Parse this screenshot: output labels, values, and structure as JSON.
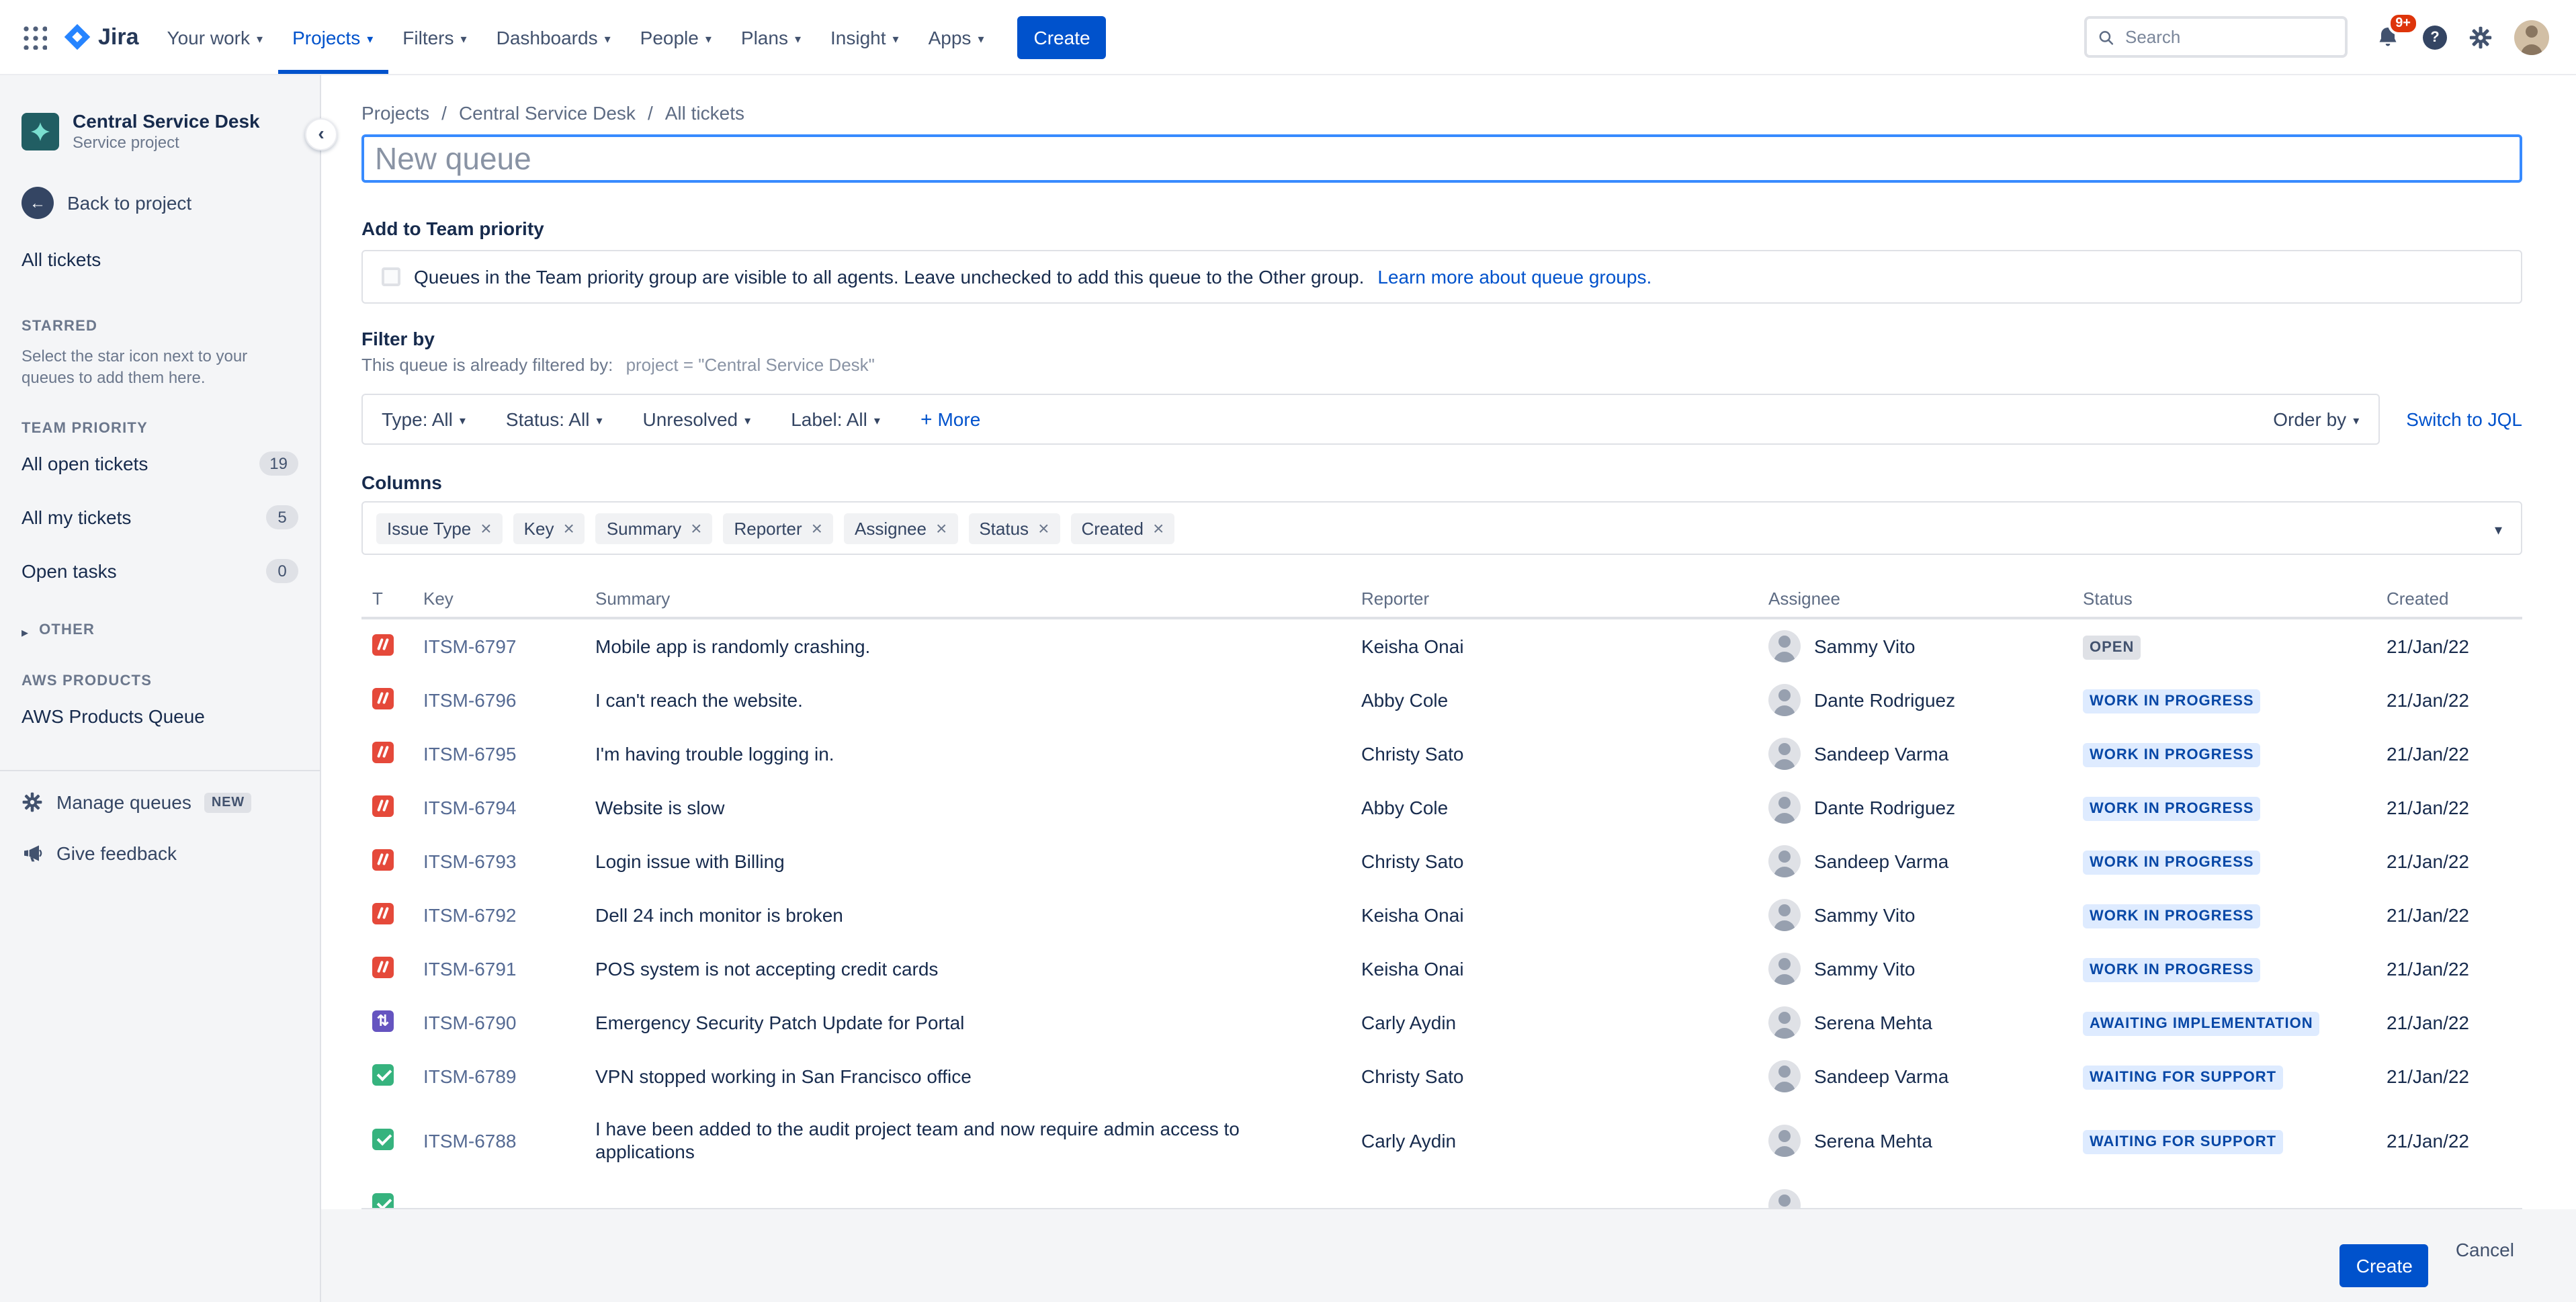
{
  "colors": {
    "accent": "#0052CC",
    "incident_icon": "#E5493A",
    "change_icon": "#6554C0",
    "request_icon": "#36B37E",
    "badge_blue_bg": "#DEEBFF",
    "badge_blue_text": "#0747A6",
    "badge_gray_bg": "#DFE1E6",
    "notification_badge_bg": "#DE350B"
  },
  "nav": {
    "logo": "Jira",
    "items": [
      {
        "label": "Your work"
      },
      {
        "label": "Projects"
      },
      {
        "label": "Filters"
      },
      {
        "label": "Dashboards"
      },
      {
        "label": "People"
      },
      {
        "label": "Plans"
      },
      {
        "label": "Insight"
      },
      {
        "label": "Apps"
      }
    ],
    "create_label": "Create",
    "search_placeholder": "Search",
    "notification_badge": "9+"
  },
  "sidebar": {
    "project_name": "Central Service Desk",
    "project_type": "Service project",
    "back_label": "Back to project",
    "all_tickets_label": "All tickets",
    "starred_heading": "STARRED",
    "starred_hint": "Select the star icon next to your queues to add them here.",
    "team_priority_heading": "TEAM PRIORITY",
    "queues": [
      {
        "label": "All open tickets",
        "count": "19"
      },
      {
        "label": "All my tickets",
        "count": "5"
      },
      {
        "label": "Open tasks",
        "count": "0"
      }
    ],
    "other_heading": "OTHER",
    "aws_heading": "AWS PRODUCTS",
    "aws_queue_label": "AWS Products Queue",
    "manage_queues_label": "Manage queues",
    "new_badge": "NEW",
    "feedback_label": "Give feedback"
  },
  "main": {
    "breadcrumb": [
      {
        "label": "Projects"
      },
      {
        "label": "Central Service Desk"
      },
      {
        "label": "All tickets"
      }
    ],
    "queue_name_placeholder": "New queue",
    "team_priority": {
      "heading": "Add to Team priority",
      "checkbox_text": "Queues in the Team priority group are visible to all agents. Leave unchecked to add this queue to the Other group.",
      "link_label": "Learn more about queue groups."
    },
    "filter": {
      "heading": "Filter by",
      "prefilter_label": "This queue is already filtered by:",
      "prefilter_jql": "project = \"Central Service Desk\"",
      "dropdowns": [
        {
          "label": "Type: All"
        },
        {
          "label": "Status: All"
        },
        {
          "label": "Unresolved"
        },
        {
          "label": "Label: All"
        }
      ],
      "more_label": "More",
      "order_by_label": "Order by",
      "switch_jql_label": "Switch to JQL"
    },
    "columns": {
      "heading": "Columns",
      "chips": [
        {
          "label": "Issue Type"
        },
        {
          "label": "Key"
        },
        {
          "label": "Summary"
        },
        {
          "label": "Reporter"
        },
        {
          "label": "Assignee"
        },
        {
          "label": "Status"
        },
        {
          "label": "Created"
        }
      ]
    },
    "table": {
      "headers": {
        "type": "T",
        "key": "Key",
        "summary": "Summary",
        "reporter": "Reporter",
        "assignee": "Assignee",
        "status": "Status",
        "created": "Created"
      },
      "rows": [
        {
          "type": "incident",
          "key": "ITSM-6797",
          "summary": "Mobile app is randomly crashing.",
          "reporter": "Keisha Onai",
          "assignee": "Sammy Vito",
          "status": "OPEN",
          "created": "21/Jan/22"
        },
        {
          "type": "incident",
          "key": "ITSM-6796",
          "summary": "I can't reach the website.",
          "reporter": "Abby Cole",
          "assignee": "Dante Rodriguez",
          "status": "WORK IN PROGRESS",
          "created": "21/Jan/22"
        },
        {
          "type": "incident",
          "key": "ITSM-6795",
          "summary": "I'm having trouble logging in.",
          "reporter": "Christy Sato",
          "assignee": "Sandeep Varma",
          "status": "WORK IN PROGRESS",
          "created": "21/Jan/22"
        },
        {
          "type": "incident",
          "key": "ITSM-6794",
          "summary": "Website is slow",
          "reporter": "Abby Cole",
          "assignee": "Dante Rodriguez",
          "status": "WORK IN PROGRESS",
          "created": "21/Jan/22"
        },
        {
          "type": "incident",
          "key": "ITSM-6793",
          "summary": "Login issue with Billing",
          "reporter": "Christy Sato",
          "assignee": "Sandeep Varma",
          "status": "WORK IN PROGRESS",
          "created": "21/Jan/22"
        },
        {
          "type": "incident",
          "key": "ITSM-6792",
          "summary": "Dell 24 inch monitor is broken",
          "reporter": "Keisha Onai",
          "assignee": "Sammy Vito",
          "status": "WORK IN PROGRESS",
          "created": "21/Jan/22"
        },
        {
          "type": "incident",
          "key": "ITSM-6791",
          "summary": "POS system is not accepting credit cards",
          "reporter": "Keisha Onai",
          "assignee": "Sammy Vito",
          "status": "WORK IN PROGRESS",
          "created": "21/Jan/22"
        },
        {
          "type": "change",
          "key": "ITSM-6790",
          "summary": "Emergency Security Patch Update for Portal",
          "reporter": "Carly Aydin",
          "assignee": "Serena Mehta",
          "status": "AWAITING IMPLEMENTATION",
          "created": "21/Jan/22"
        },
        {
          "type": "request",
          "key": "ITSM-6789",
          "summary": "VPN stopped working in San Francisco office",
          "reporter": "Christy Sato",
          "assignee": "Sandeep Varma",
          "status": "WAITING FOR SUPPORT",
          "created": "21/Jan/22"
        },
        {
          "type": "request",
          "key": "ITSM-6788",
          "summary": "I have been added to the audit project team and now require admin access to applications",
          "reporter": "Carly Aydin",
          "assignee": "Serena Mehta",
          "status": "WAITING FOR SUPPORT",
          "created": "21/Jan/22"
        }
      ],
      "partial_row": {
        "type": "request"
      }
    },
    "footer": {
      "create_label": "Create",
      "cancel_label": "Cancel"
    }
  }
}
